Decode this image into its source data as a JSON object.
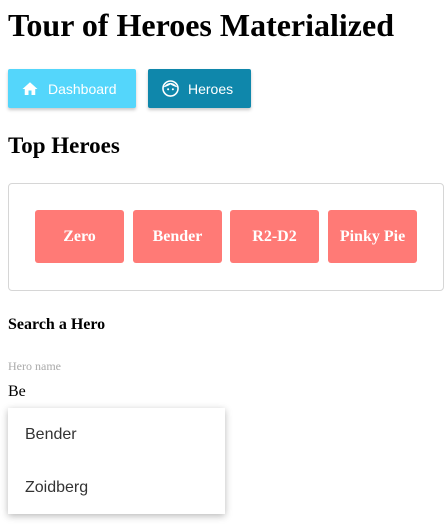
{
  "app": {
    "title": "Tour of Heroes Materialized"
  },
  "nav": {
    "dashboard_label": "Dashboard",
    "dashboard_icon": "home-icon",
    "heroes_label": "Heroes",
    "heroes_icon": "face-icon"
  },
  "top_heroes": {
    "title": "Top Heroes",
    "heroes": [
      "Zero",
      "Bender",
      "R2-D2",
      "Pinky Pie"
    ]
  },
  "search": {
    "title": "Search a Hero",
    "field_label": "Hero name",
    "value": "Be",
    "suggestions": [
      "Bender",
      "Zoidberg"
    ]
  },
  "colors": {
    "dashboard_button": "#54d6fb",
    "heroes_button": "#0f87ab",
    "hero_card": "#ff7a76"
  }
}
